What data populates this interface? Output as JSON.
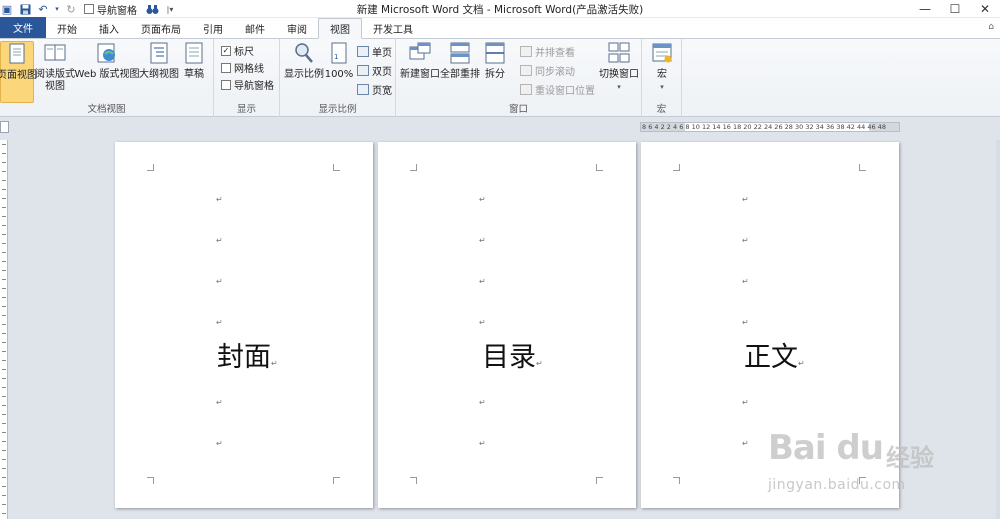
{
  "window": {
    "title": "新建 Microsoft Word 文档 - Microsoft Word(产品激活失败)",
    "quick_access": {
      "nav_pane_label": "导航窗格"
    },
    "controls": {
      "minimize": "—",
      "maximize": "☐",
      "close": "✕"
    }
  },
  "tabs": {
    "file": "文件",
    "items": [
      "开始",
      "插入",
      "页面布局",
      "引用",
      "邮件",
      "审阅",
      "视图",
      "开发工具"
    ],
    "active": "视图"
  },
  "ribbon": {
    "document_views": {
      "label": "文档视图",
      "page_view": "页面视图",
      "reading_line1": "阅读版式",
      "reading_line2": "视图",
      "web_view": "Web 版式视图",
      "outline_view": "大纲视图",
      "draft": "草稿"
    },
    "show": {
      "label": "显示",
      "ruler": "标尺",
      "gridlines": "网格线",
      "nav_pane": "导航窗格",
      "ruler_checked": true,
      "gridlines_checked": false,
      "nav_pane_checked": false
    },
    "zoom": {
      "label": "显示比例",
      "zoom": "显示比例",
      "hundred": "100%",
      "one_page": "单页",
      "two_pages": "双页",
      "page_width": "页宽"
    },
    "window": {
      "label": "窗口",
      "new_window": "新建窗口",
      "arrange_all": "全部重排",
      "split": "拆分",
      "side_by_side": "并排查看",
      "sync_scroll": "同步滚动",
      "reset_position": "重设窗口位置",
      "switch_windows": "切换窗口"
    },
    "macros": {
      "label": "宏",
      "macros": "宏"
    }
  },
  "ruler_text": "8 6 4 2   2 4 6 8 10 12 14 16 18 20 22 24 26 28 30 32 34 36 38   42 44 46 48",
  "paragraph_mark": "↵",
  "pages": [
    {
      "title": "封面"
    },
    {
      "title": "目录"
    },
    {
      "title": "正文"
    }
  ],
  "watermark": {
    "brand": "Bai du",
    "brand_cn": "经验",
    "url": "jingyan.baidu.com"
  },
  "colors": {
    "file_tab": "#2b579a",
    "selected_button": "#fcd67b",
    "workspace": "#dfe4ea"
  }
}
